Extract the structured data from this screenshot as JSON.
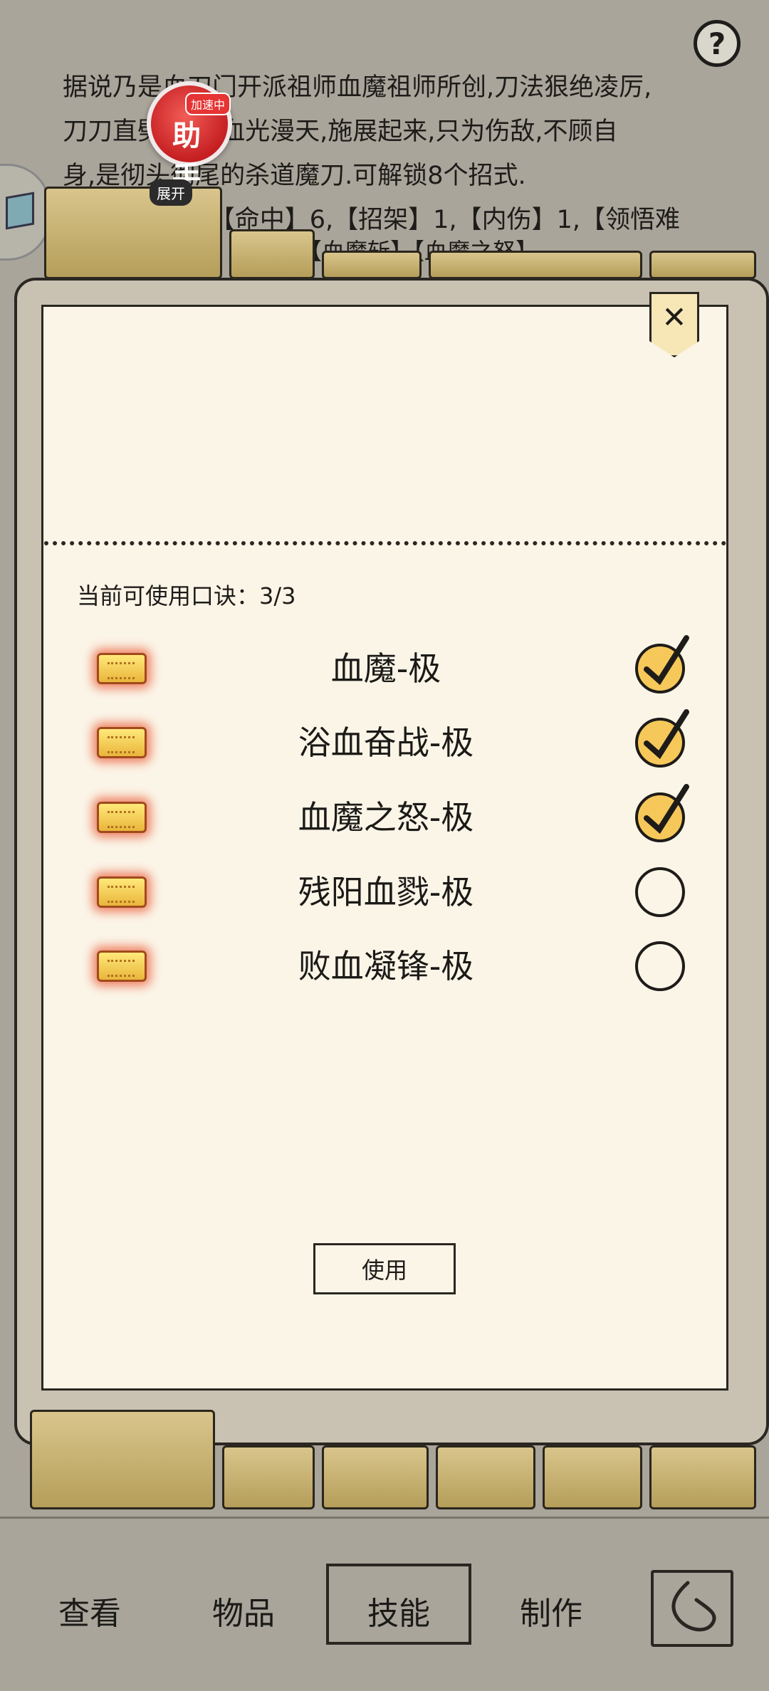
{
  "background": {
    "description_lines": [
      "据说乃是血刀门开派祖师血魔祖师所创,刀法狠绝凌厉,",
      "刀刀直劈,招招血光漫天,施展起来,只为伤敌,不顾自",
      "身,是彻头彻尾的杀道魔刀.可解锁8个招式.",
      "【伤害】1.5,【命中】6,【招架】1,【内伤】1,【领悟难"
    ],
    "tabs_line": "【血魔斩】【血魔之怒】"
  },
  "help_button": "?",
  "float_helper": {
    "badge": "加速中",
    "glyph": "助手",
    "expand_label": "展开"
  },
  "dialog": {
    "close_label": "✕",
    "quota_label": "当前可使用口诀：",
    "quota_value": "3/3",
    "skills": [
      {
        "name": "血魔-极",
        "checked": true
      },
      {
        "name": "浴血奋战-极",
        "checked": true
      },
      {
        "name": "血魔之怒-极",
        "checked": true
      },
      {
        "name": "残阳血戮-极",
        "checked": false
      },
      {
        "name": "败血凝锋-极",
        "checked": false
      }
    ],
    "use_button": "使用"
  },
  "bottom_nav": {
    "items": [
      "查看",
      "物品",
      "技能",
      "制作"
    ],
    "active": "技能"
  }
}
